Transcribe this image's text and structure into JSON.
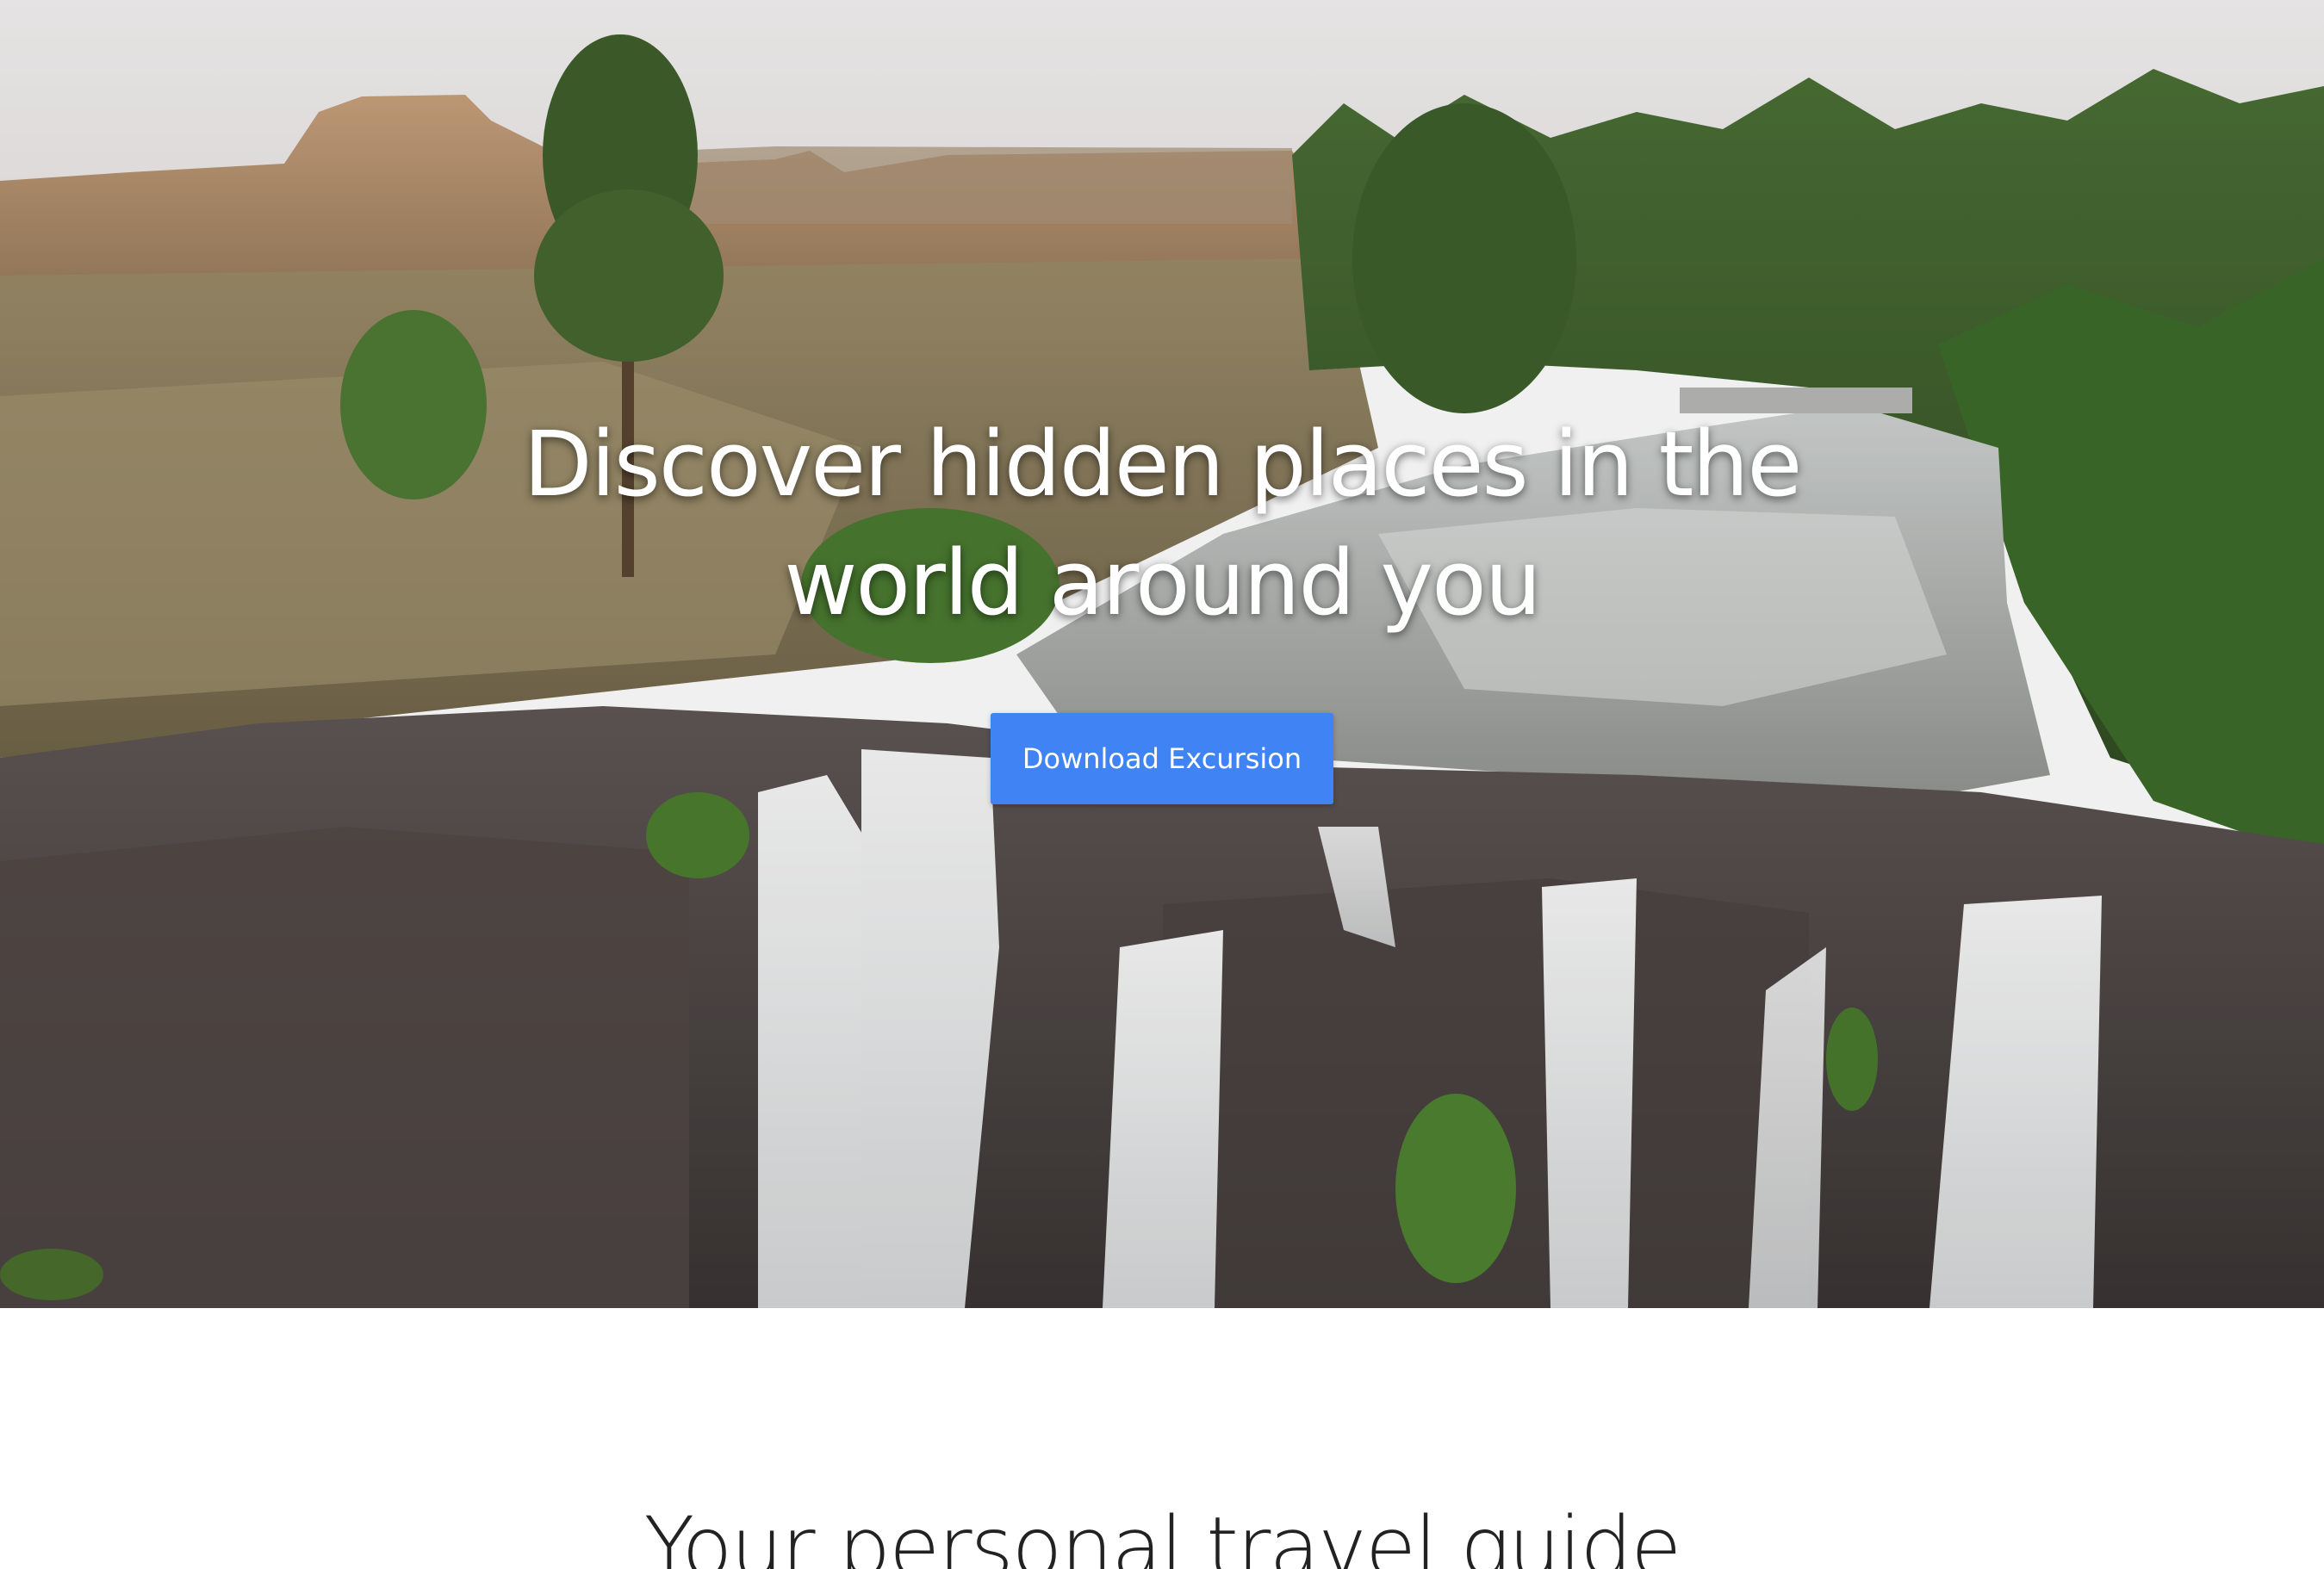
{
  "hero": {
    "title": "Discover hidden places in the world around you",
    "download_button_label": "Download Excursion",
    "background_image": "waterfall-landscape",
    "accent_color": "#3f83f4"
  },
  "intro": {
    "heading": "Your personal travel guide"
  }
}
